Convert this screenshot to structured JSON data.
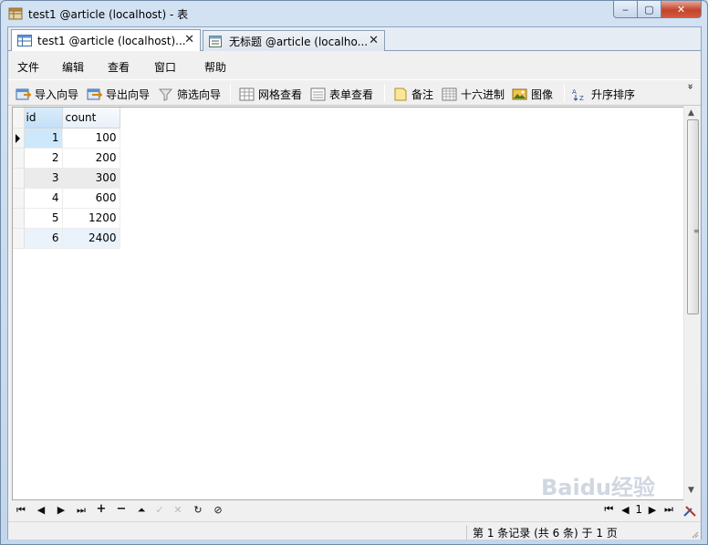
{
  "window": {
    "title": "test1 @article (localhost) - 表",
    "controls": {
      "minimize": "‒",
      "maximize": "▢",
      "close": "✕"
    }
  },
  "tabs": [
    {
      "label": "test1 @article (localhost)...",
      "active": true,
      "icon": "table-icon"
    },
    {
      "label": "无标题 @article (localho...",
      "active": false,
      "icon": "query-icon"
    }
  ],
  "menu": [
    "文件",
    "编辑",
    "查看",
    "窗口",
    "帮助"
  ],
  "toolbar": {
    "import_wizard": "导入向导",
    "export_wizard": "导出向导",
    "filter_wizard": "筛选向导",
    "grid_view": "网格查看",
    "form_view": "表单查看",
    "memo": "备注",
    "hex": "十六进制",
    "image": "图像",
    "sort_asc": "升序排序",
    "overflow": "»"
  },
  "grid": {
    "columns": [
      "id",
      "count"
    ],
    "rows": [
      {
        "id": "1",
        "count": "100"
      },
      {
        "id": "2",
        "count": "200"
      },
      {
        "id": "3",
        "count": "300"
      },
      {
        "id": "4",
        "count": "600"
      },
      {
        "id": "5",
        "count": "1200"
      },
      {
        "id": "6",
        "count": "2400"
      }
    ],
    "selected_row": 1
  },
  "navigation": {
    "buttons": [
      "first",
      "prev",
      "next",
      "last",
      "add",
      "delete",
      "up",
      "apply",
      "cancel",
      "refresh",
      "stop"
    ],
    "page": "1"
  },
  "status": {
    "text": "第 1 条记录 (共 6 条) 于 1 页"
  },
  "watermark": "Baidu经验",
  "colors": {
    "selection": "#cde8fb",
    "frame": "#c2d6ec"
  }
}
